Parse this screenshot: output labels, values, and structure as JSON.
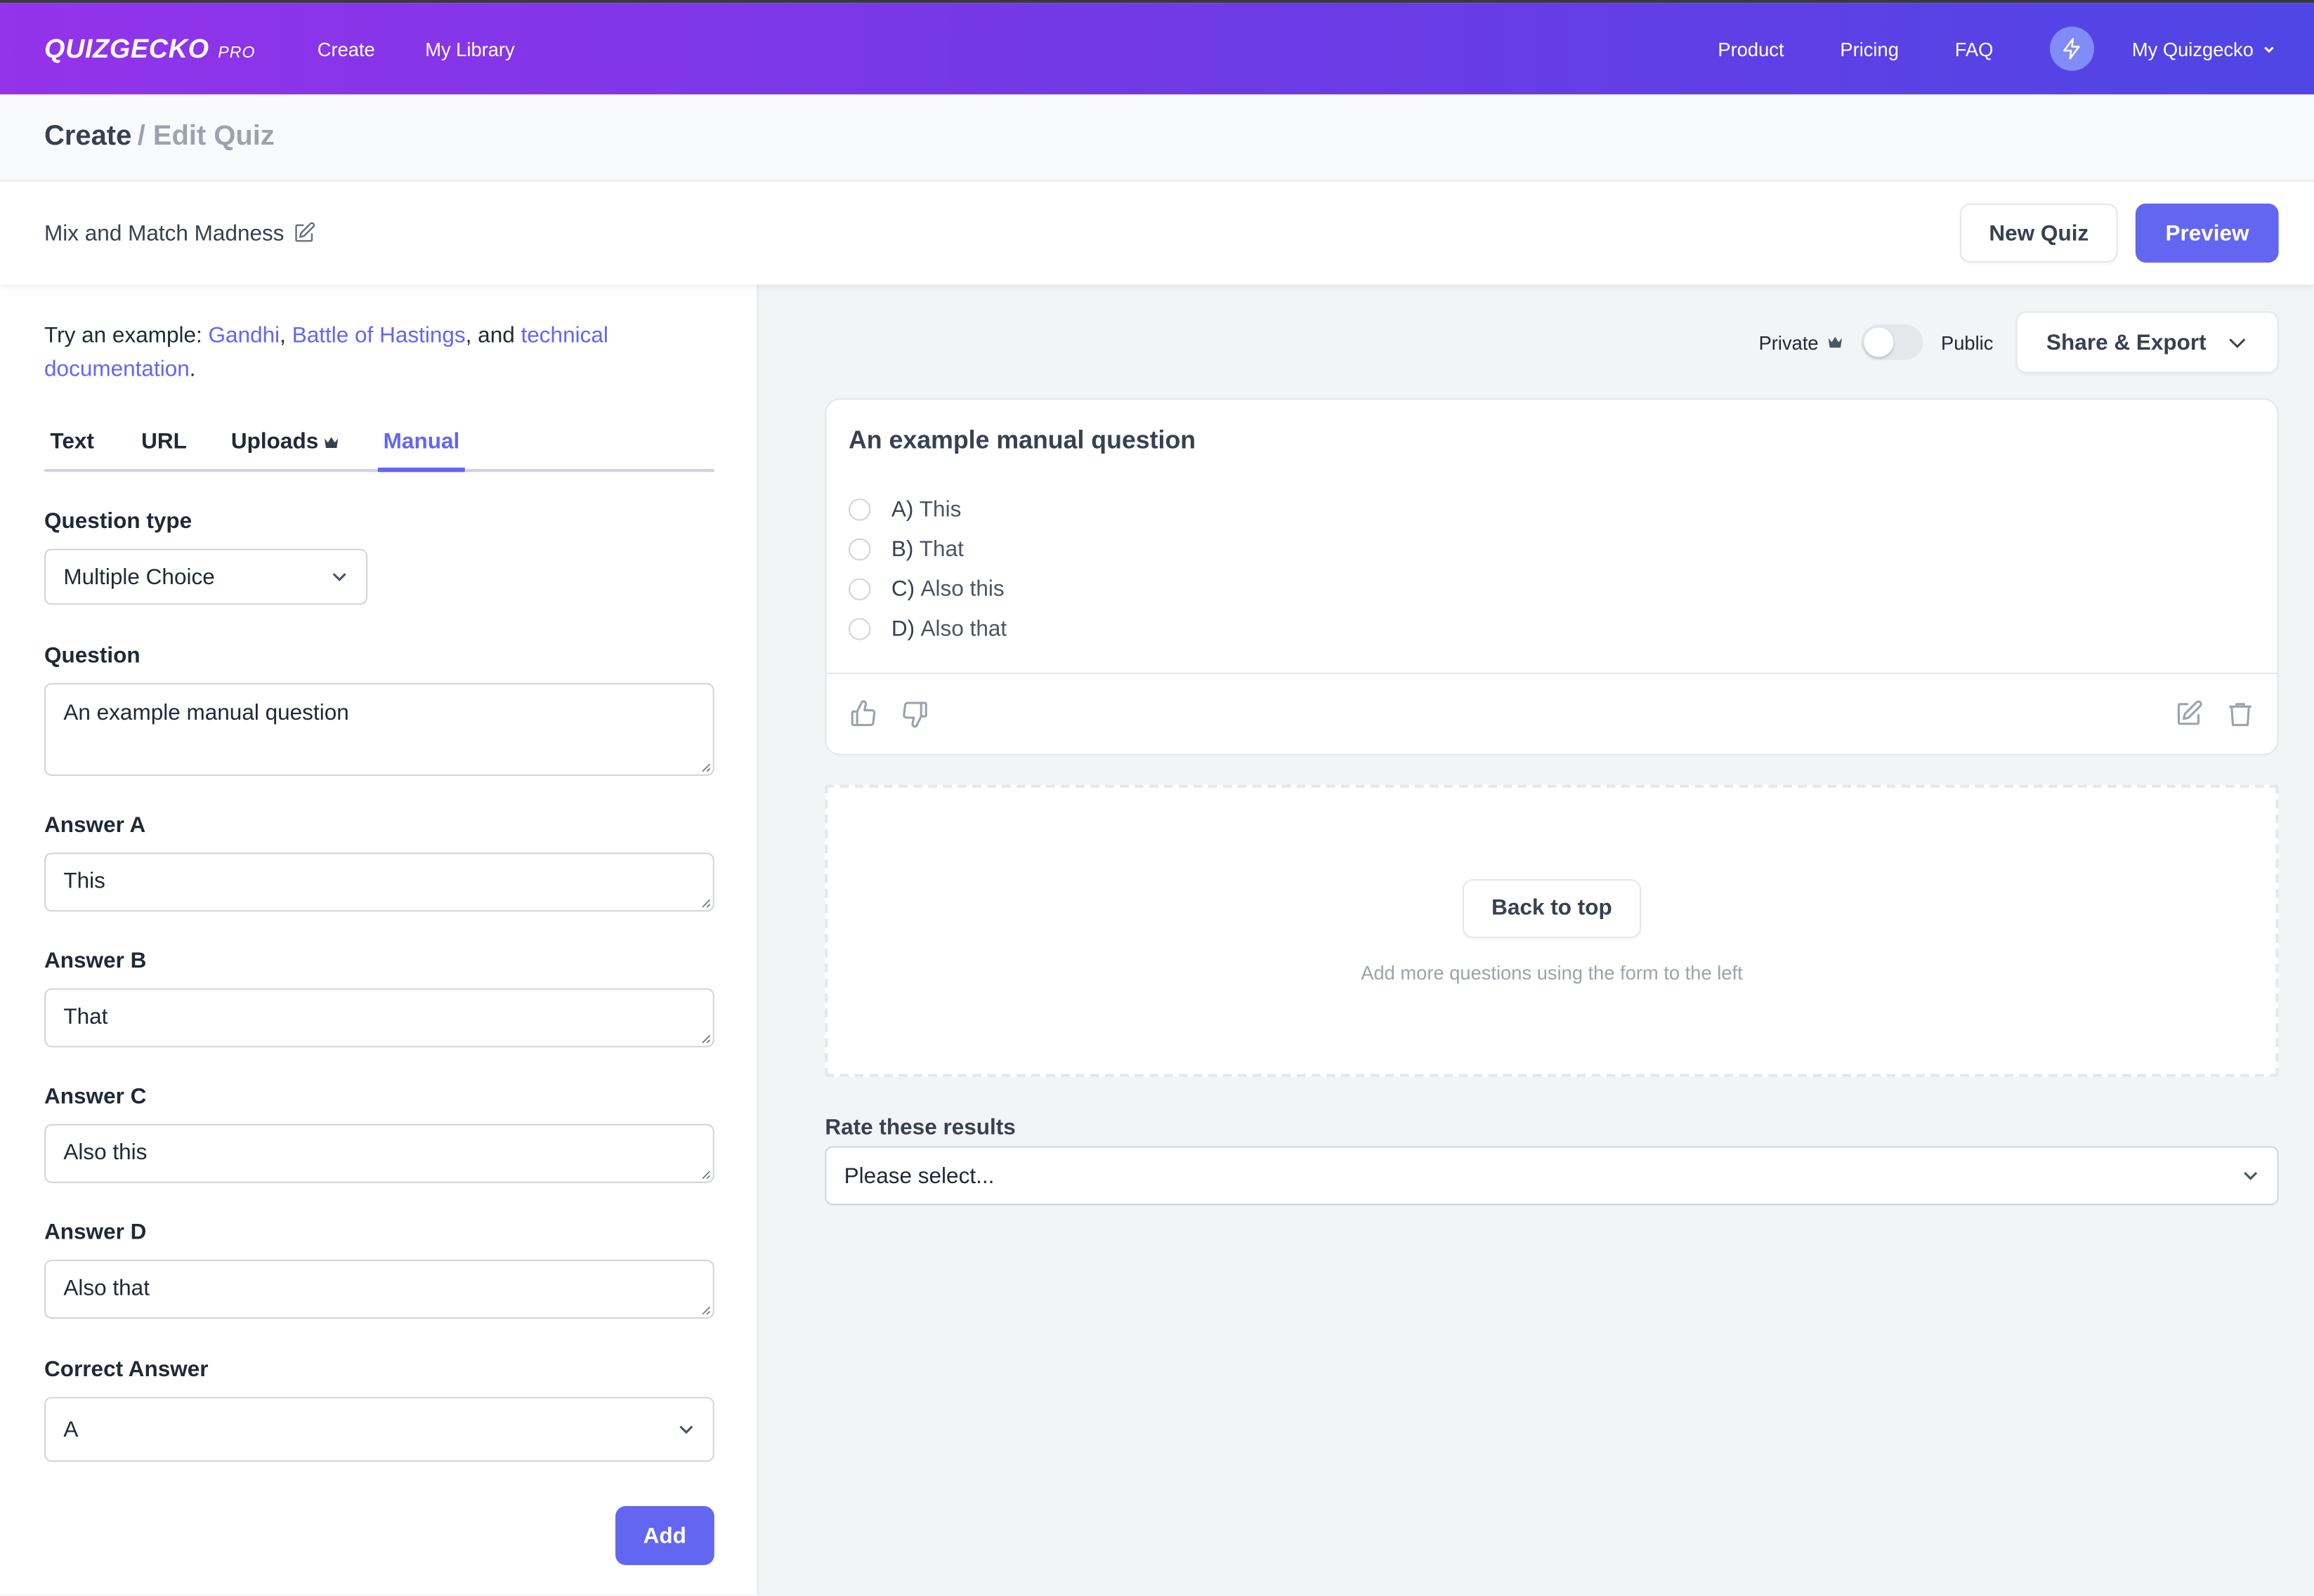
{
  "nav": {
    "logo": "QUIZGECKO",
    "logo_badge": "PRO",
    "links": [
      "Create",
      "My Library"
    ],
    "right_links": [
      "Product",
      "Pricing",
      "FAQ"
    ],
    "account": "My Quizgecko"
  },
  "breadcrumb": {
    "current": "Create",
    "sub": "/ Edit Quiz"
  },
  "quiz": {
    "title": "Mix and Match Madness",
    "new_quiz": "New Quiz",
    "preview": "Preview"
  },
  "left": {
    "example_prefix": "Try an example: ",
    "examples": [
      "Gandhi",
      "Battle of Hastings",
      "technical documentation"
    ],
    "sep1": ", ",
    "sep2": ", and ",
    "end": ".",
    "tabs": [
      "Text",
      "URL",
      "Uploads",
      "Manual"
    ],
    "active_tab": "Manual",
    "question_type_label": "Question type",
    "question_type_value": "Multiple Choice",
    "question_label": "Question",
    "question_value": "An example manual question",
    "answers": [
      {
        "label": "Answer A",
        "value": "This"
      },
      {
        "label": "Answer B",
        "value": "That"
      },
      {
        "label": "Answer C",
        "value": "Also this"
      },
      {
        "label": "Answer D",
        "value": "Also that"
      }
    ],
    "correct_label": "Correct Answer",
    "correct_value": "A",
    "add": "Add"
  },
  "right": {
    "private_label": "Private",
    "public_label": "Public",
    "visibility_public": false,
    "share_export": "Share & Export",
    "question_card": {
      "title": "An example manual question",
      "options": [
        {
          "letter": "A)",
          "text": "This"
        },
        {
          "letter": "B)",
          "text": "That"
        },
        {
          "letter": "C)",
          "text": "Also this"
        },
        {
          "letter": "D)",
          "text": "Also that"
        }
      ]
    },
    "back_to_top": "Back to top",
    "hint": "Add more questions using the form to the left",
    "rate_label": "Rate these results",
    "rate_value": "Please select..."
  },
  "colors": {
    "accent": "#6366f1",
    "nav_gradient_start": "#9333ea",
    "nav_gradient_end": "#4f46e5",
    "bolt_circle": "#818cf8"
  }
}
